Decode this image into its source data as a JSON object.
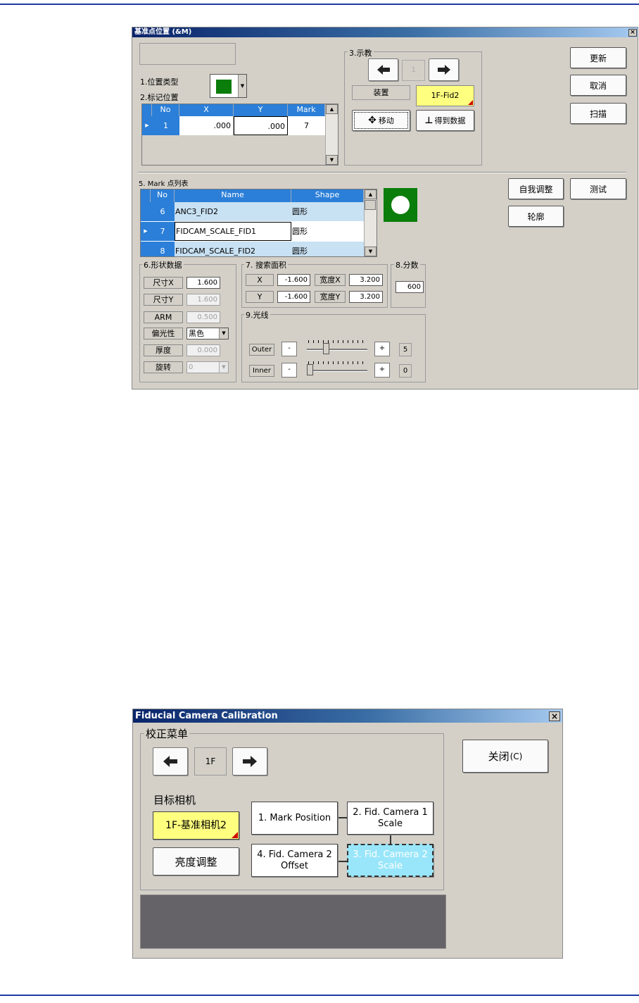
{
  "top_window": {
    "title": "基准点位置 (&M)",
    "close_glyph": "×",
    "position_type_label": "1.位置类型",
    "position_type_color": "#0a7d0a",
    "mark_position_label": "2.标记位置",
    "mark_table": {
      "headers": [
        "No",
        "X",
        "Y",
        "Mark"
      ],
      "rows": [
        {
          "no": "1",
          "x": ".000",
          "y": ".000",
          "mark": "7"
        }
      ]
    },
    "teach_group": {
      "label": "3.示教",
      "page": "1",
      "device_label": "装置",
      "device_value": "1F-Fid2",
      "move_button": "移动",
      "get_data_button": "得到数据"
    },
    "buttons": {
      "update": "更新",
      "cancel": "取消",
      "scan": "扫描",
      "auto_adjust": "自我调整",
      "test": "测试",
      "outline": "轮廓"
    },
    "mark_list": {
      "label": "5. Mark 点列表",
      "headers": [
        "No",
        "Name",
        "Shape"
      ],
      "rows": [
        {
          "no": "6",
          "name": "ANC3_FID2",
          "shape": "圆形"
        },
        {
          "no": "7",
          "name": "FIDCAM_SCALE_FID1",
          "shape": "圆形"
        },
        {
          "no": "8",
          "name": "FIDCAM_SCALE_FID2",
          "shape": "圆形"
        }
      ]
    },
    "shape_data": {
      "label": "6.形状数据",
      "size_x_label": "尺寸X",
      "size_x": "1.600",
      "size_y_label": "尺寸Y",
      "size_y": "1.600",
      "arm_label": "ARM",
      "arm": "0.500",
      "polarity_label": "偏光性",
      "polarity": "黑色",
      "thickness_label": "厚度",
      "thickness": "0.000",
      "rotation_label": "旋转",
      "rotation": "0"
    },
    "search_area": {
      "label": "7. 搜索面积",
      "x_label": "X",
      "x": "-1.600",
      "width_x_label": "宽度X",
      "width_x": "3.200",
      "y_label": "Y",
      "y": "-1.600",
      "width_y_label": "宽度Y",
      "width_y": "3.200"
    },
    "score": {
      "label": "8.分数",
      "value": "600"
    },
    "light": {
      "label": "9.光线",
      "outer_label": "Outer",
      "outer_value": "5",
      "outer_level": 0.3,
      "inner_label": "Inner",
      "inner_value": "0",
      "inner_level": 0.0,
      "minus": "-",
      "plus": "+"
    }
  },
  "bottom_window": {
    "title": "Fiducial Camera Calibration",
    "close_glyph": "×",
    "menu_label": "校正菜单",
    "floor": "1F",
    "target_camera_label": "目标相机",
    "target_camera_value": "1F-基准相机2",
    "brightness_button": "亮度调整",
    "close_button": "关闭",
    "close_shortcut": "(C)",
    "steps": {
      "step1": "1. Mark Position",
      "step2_line1": "2. Fid. Camera 1",
      "step2_line2": "Scale",
      "step3_line1": "3. Fid. Camera 2",
      "step3_line2": "Scale",
      "step4_line1": "4. Fid. Camera 2",
      "step4_line2": "Offset"
    }
  }
}
